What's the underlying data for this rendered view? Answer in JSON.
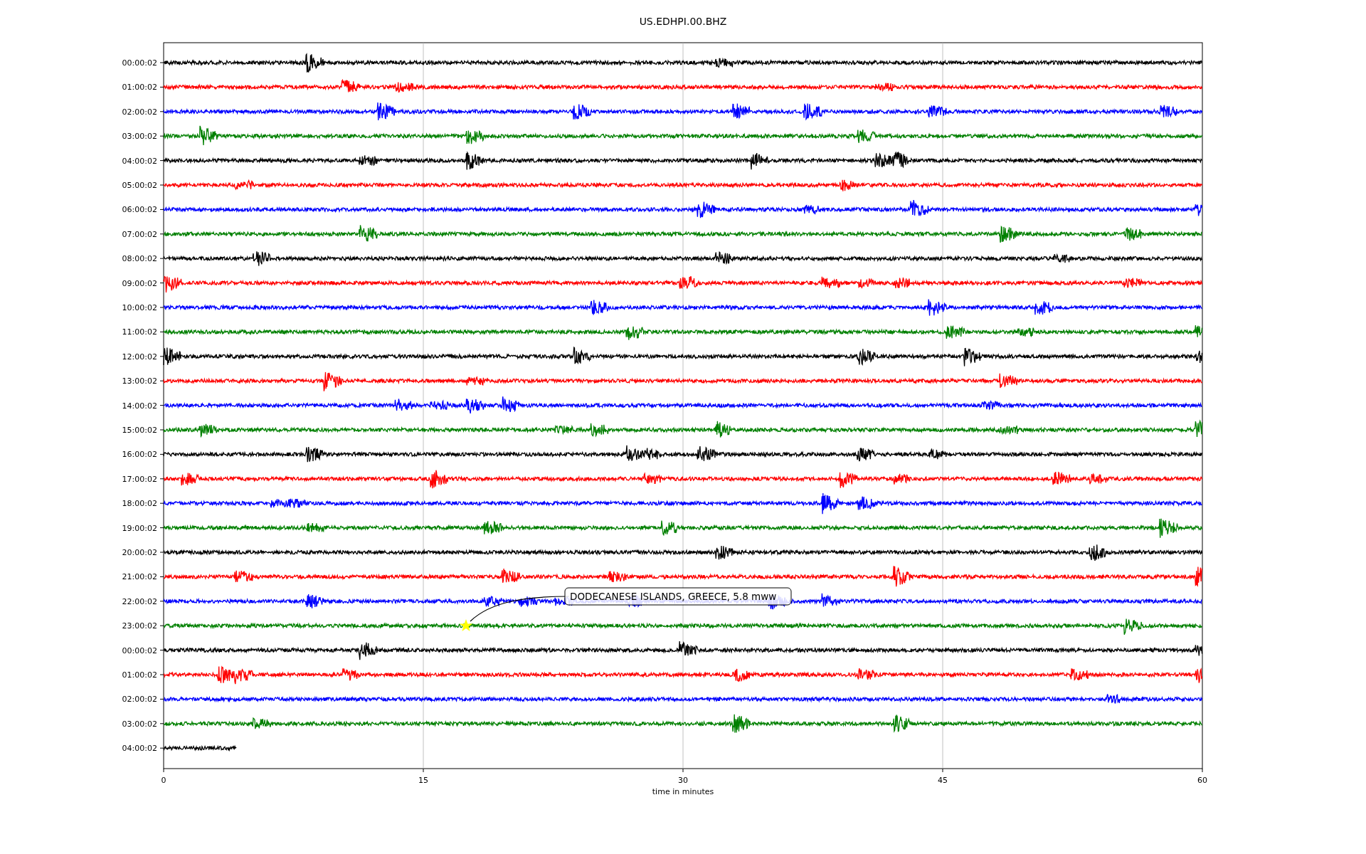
{
  "title": "US.EDHPI.00.BHZ",
  "traces": [
    {
      "label": "00:00:02",
      "color": "#000000",
      "complete": true
    },
    {
      "label": "01:00:02",
      "color": "#ff0000",
      "complete": true
    },
    {
      "label": "02:00:02",
      "color": "#0000ff",
      "complete": true
    },
    {
      "label": "03:00:02",
      "color": "#008000",
      "complete": true
    },
    {
      "label": "04:00:02",
      "color": "#000000",
      "complete": true
    },
    {
      "label": "05:00:02",
      "color": "#ff0000",
      "complete": true
    },
    {
      "label": "06:00:02",
      "color": "#0000ff",
      "complete": true
    },
    {
      "label": "07:00:02",
      "color": "#008000",
      "complete": true
    },
    {
      "label": "08:00:02",
      "color": "#000000",
      "complete": true
    },
    {
      "label": "09:00:02",
      "color": "#ff0000",
      "complete": true
    },
    {
      "label": "10:00:02",
      "color": "#0000ff",
      "complete": true
    },
    {
      "label": "11:00:02",
      "color": "#008000",
      "complete": true
    },
    {
      "label": "12:00:02",
      "color": "#000000",
      "complete": true
    },
    {
      "label": "13:00:02",
      "color": "#ff0000",
      "complete": true
    },
    {
      "label": "14:00:02",
      "color": "#0000ff",
      "complete": true
    },
    {
      "label": "15:00:02",
      "color": "#008000",
      "complete": true
    },
    {
      "label": "16:00:02",
      "color": "#000000",
      "complete": true
    },
    {
      "label": "17:00:02",
      "color": "#ff0000",
      "complete": true
    },
    {
      "label": "18:00:02",
      "color": "#0000ff",
      "complete": true
    },
    {
      "label": "19:00:02",
      "color": "#008000",
      "complete": true
    },
    {
      "label": "20:00:02",
      "color": "#000000",
      "complete": true
    },
    {
      "label": "21:00:02",
      "color": "#ff0000",
      "complete": true
    },
    {
      "label": "22:00:02",
      "color": "#0000ff",
      "complete": true
    },
    {
      "label": "23:00:02",
      "color": "#008000",
      "complete": true
    },
    {
      "label": "00:00:02",
      "color": "#000000",
      "complete": true
    },
    {
      "label": "01:00:02",
      "color": "#ff0000",
      "complete": true
    },
    {
      "label": "02:00:02",
      "color": "#0000ff",
      "complete": true
    },
    {
      "label": "03:00:02",
      "color": "#008000",
      "complete": true
    },
    {
      "label": "04:00:02",
      "color": "#000000",
      "complete": false
    }
  ],
  "x_axis": {
    "ticks": [
      "0",
      "15",
      "30",
      "45",
      "60"
    ],
    "label": "time in minutes"
  },
  "annotation": {
    "text": "DODECANESE ISLANDS, GREECE, 5.8 mww"
  }
}
